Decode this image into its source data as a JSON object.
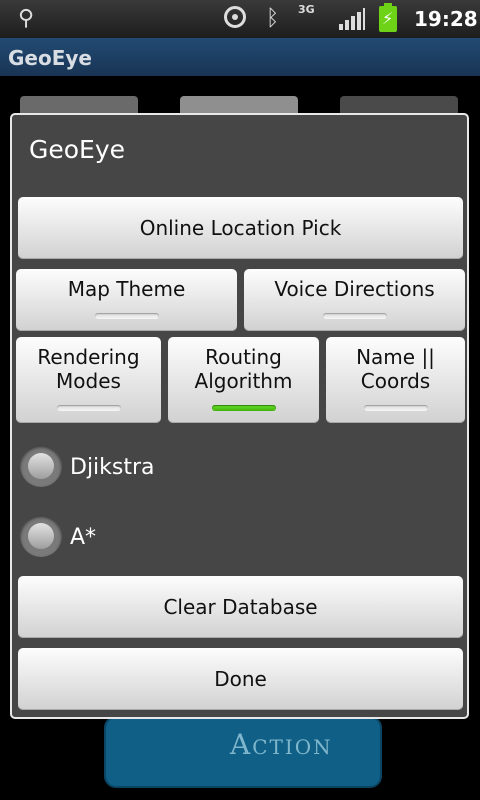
{
  "status_bar": {
    "usb_icon": "usb-icon",
    "gps_icon": "gps-icon",
    "bluetooth_icon": "bluetooth-icon",
    "network_type": "3G",
    "signal_icon": "signal-bars-icon",
    "battery_icon": "battery-charging-icon",
    "time": "19:28",
    "battery_color": "#6ed316"
  },
  "app": {
    "title": "GeoEye",
    "background_button_text": "Action"
  },
  "dialog": {
    "title": "GeoEye",
    "online_location_pick": "Online Location Pick",
    "toggles_row1": [
      {
        "label": "Map Theme",
        "on": false
      },
      {
        "label": "Voice Directions",
        "on": false
      }
    ],
    "toggles_row2": [
      {
        "label": "Rendering Modes",
        "on": false
      },
      {
        "label": "Routing Algorithm",
        "on": true
      },
      {
        "label": "Name || Coords",
        "on": false
      }
    ],
    "radios": [
      {
        "label": "Djikstra",
        "checked": false
      },
      {
        "label": "A*",
        "checked": false
      }
    ],
    "clear_database": "Clear Database",
    "done": "Done",
    "accent_on_color": "#5bd11f"
  }
}
